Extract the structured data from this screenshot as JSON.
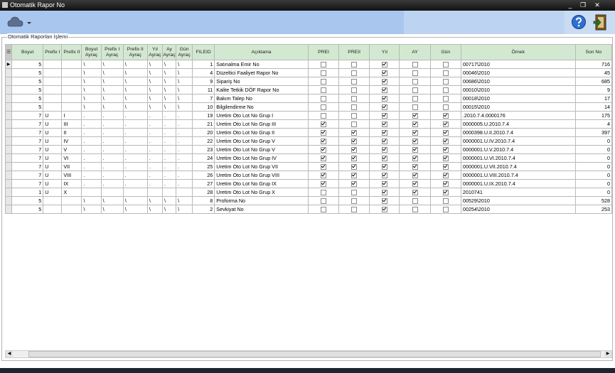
{
  "window": {
    "title": "Otomatik Rapor No"
  },
  "icons": {
    "app": "app-icon",
    "minimize": "minimize-icon",
    "restore": "restore-icon",
    "close": "close-icon",
    "toolbar_menu": "cloud-menu-icon",
    "help": "help-icon",
    "exit": "exit-door-icon",
    "scroll_left": "arrow-left-icon",
    "scroll_right": "arrow-right-icon"
  },
  "window_buttons": {
    "minimize": "_",
    "restore": "❐",
    "close": "✕"
  },
  "colors": {
    "toolbar": "#a9c6ee",
    "header": "#d3e8d0",
    "title_bar": "#1f1f1f"
  },
  "group": {
    "label": "Otomatik Raporlan İşlemi"
  },
  "grid": {
    "columns": [
      "Boyut",
      "Prefix I",
      "Prefix II",
      "Boyut Ayraç",
      "Prefix I Ayraç",
      "Prefix II Ayraç",
      "Yıl Ayraç",
      "Ay Ayraç",
      "Gün Ayraç",
      "FILEID",
      "Açıklama",
      "PREI",
      "PREII",
      "Yıl",
      "AY",
      "Gün",
      "Örnek",
      "Son No"
    ],
    "rows": [
      {
        "boyut": "5",
        "p1": "",
        "p2": "",
        "ba": "\\",
        "p1a": "\\",
        "p2a": "\\",
        "ya": "\\",
        "aa": "\\",
        "ga": "\\",
        "fileid": "1",
        "aciklama": "Satınalma Emir No",
        "prei": false,
        "preii": false,
        "yil": true,
        "ay": false,
        "gun": false,
        "ornek": "00717\\2010",
        "sonno": "716"
      },
      {
        "boyut": "5",
        "p1": "",
        "p2": "",
        "ba": "\\",
        "p1a": "\\",
        "p2a": "\\",
        "ya": "\\",
        "aa": "\\",
        "ga": "\\",
        "fileid": "4",
        "aciklama": "Düzeltici Faaliyet Rapor No",
        "prei": false,
        "preii": false,
        "yil": true,
        "ay": false,
        "gun": false,
        "ornek": "00046\\2010",
        "sonno": "45"
      },
      {
        "boyut": "5",
        "p1": "",
        "p2": "",
        "ba": "\\",
        "p1a": "\\",
        "p2a": "\\",
        "ya": "\\",
        "aa": "\\",
        "ga": "\\",
        "fileid": "9",
        "aciklama": "Sipariş No",
        "prei": false,
        "preii": false,
        "yil": true,
        "ay": false,
        "gun": false,
        "ornek": "00686\\2010",
        "sonno": "685"
      },
      {
        "boyut": "5",
        "p1": "",
        "p2": "",
        "ba": "\\",
        "p1a": "\\",
        "p2a": "\\",
        "ya": "\\",
        "aa": "\\",
        "ga": "\\",
        "fileid": "11",
        "aciklama": "Kalite Tetkik DÖF Rapor No",
        "prei": false,
        "preii": false,
        "yil": true,
        "ay": false,
        "gun": false,
        "ornek": "00010\\2010",
        "sonno": "9"
      },
      {
        "boyut": "5",
        "p1": "",
        "p2": "",
        "ba": "\\",
        "p1a": "\\",
        "p2a": "\\",
        "ya": "\\",
        "aa": "\\",
        "ga": "\\",
        "fileid": "7",
        "aciklama": "Bakım Talep No",
        "prei": false,
        "preii": false,
        "yil": true,
        "ay": false,
        "gun": false,
        "ornek": "00018\\2010",
        "sonno": "17"
      },
      {
        "boyut": "5",
        "p1": "",
        "p2": "",
        "ba": "\\",
        "p1a": "\\",
        "p2a": "\\",
        "ya": "\\",
        "aa": "\\",
        "ga": "\\",
        "fileid": "10",
        "aciklama": "Bilgilendirme No",
        "prei": false,
        "preii": false,
        "yil": true,
        "ay": false,
        "gun": false,
        "ornek": "00015\\2010",
        "sonno": "14"
      },
      {
        "boyut": "7",
        "p1": "U",
        "p2": "I",
        "ba": ".",
        "p1a": ".",
        "p2a": ".",
        "ya": ".",
        "aa": ".",
        "ga": ".",
        "fileid": "19",
        "aciklama": "Uretim Oto Lot No Grup I",
        "prei": false,
        "preii": false,
        "yil": true,
        "ay": true,
        "gun": true,
        "ornek": ".2010.7.4.0000176",
        "sonno": "175"
      },
      {
        "boyut": "7",
        "p1": "U",
        "p2": "III",
        "ba": ".",
        "p1a": ".",
        "p2a": ".",
        "ya": ".",
        "aa": ".",
        "ga": ".",
        "fileid": "21",
        "aciklama": "Uretim Oto Lot No Grup III",
        "prei": true,
        "preii": false,
        "yil": true,
        "ay": true,
        "gun": true,
        "ornek": "0000005.U.2010.7.4",
        "sonno": "4"
      },
      {
        "boyut": "7",
        "p1": "U",
        "p2": "II",
        "ba": ".",
        "p1a": ".",
        "p2a": ".",
        "ya": ".",
        "aa": ".",
        "ga": ".",
        "fileid": "20",
        "aciklama": "Uretim Oto Lot No Grup II",
        "prei": true,
        "preii": true,
        "yil": true,
        "ay": true,
        "gun": true,
        "ornek": "0000398.U.II.2010.7.4",
        "sonno": "397"
      },
      {
        "boyut": "7",
        "p1": "U",
        "p2": "IV",
        "ba": ".",
        "p1a": ".",
        "p2a": ".",
        "ya": ".",
        "aa": ".",
        "ga": ".",
        "fileid": "22",
        "aciklama": "Uretim Oto Lot No Grup V",
        "prei": true,
        "preii": true,
        "yil": true,
        "ay": true,
        "gun": true,
        "ornek": "0000001.U.IV.2010.7.4",
        "sonno": "0"
      },
      {
        "boyut": "7",
        "p1": "U",
        "p2": "V",
        "ba": ".",
        "p1a": ".",
        "p2a": ".",
        "ya": ".",
        "aa": ".",
        "ga": ".",
        "fileid": "23",
        "aciklama": "Uretim Oto Lot No Grup V",
        "prei": true,
        "preii": true,
        "yil": true,
        "ay": true,
        "gun": true,
        "ornek": "0000001.U.V.2010.7.4",
        "sonno": "0"
      },
      {
        "boyut": "7",
        "p1": "U",
        "p2": "VI",
        "ba": ".",
        "p1a": ".",
        "p2a": ".",
        "ya": ".",
        "aa": ".",
        "ga": ".",
        "fileid": "24",
        "aciklama": "Uretim Oto Lot No Grup IV",
        "prei": true,
        "preii": true,
        "yil": true,
        "ay": true,
        "gun": true,
        "ornek": "0000001.U.VI.2010.7.4",
        "sonno": "0"
      },
      {
        "boyut": "7",
        "p1": "U",
        "p2": "VII",
        "ba": ".",
        "p1a": ".",
        "p2a": ".",
        "ya": ".",
        "aa": ".",
        "ga": ".",
        "fileid": "25",
        "aciklama": "Uretim Oto Lot No Grup VII",
        "prei": true,
        "preii": true,
        "yil": true,
        "ay": true,
        "gun": true,
        "ornek": "0000001.U.VII.2010.7.4",
        "sonno": "0"
      },
      {
        "boyut": "7",
        "p1": "U",
        "p2": "VIII",
        "ba": ".",
        "p1a": ".",
        "p2a": ".",
        "ya": ".",
        "aa": ".",
        "ga": ".",
        "fileid": "26",
        "aciklama": "Uretim Oto Lot No Grup VIII",
        "prei": true,
        "preii": true,
        "yil": true,
        "ay": true,
        "gun": true,
        "ornek": "0000001.U.VIII.2010.7.4",
        "sonno": "0"
      },
      {
        "boyut": "7",
        "p1": "U",
        "p2": "IX",
        "ba": ".",
        "p1a": ".",
        "p2a": ".",
        "ya": ".",
        "aa": ".",
        "ga": ".",
        "fileid": "27",
        "aciklama": "Uretim Oto Lot No Grup IX",
        "prei": true,
        "preii": true,
        "yil": true,
        "ay": true,
        "gun": true,
        "ornek": "0000001.U.IX.2010.7.4",
        "sonno": "0"
      },
      {
        "boyut": "1",
        "p1": "U",
        "p2": "X",
        "ba": "",
        "p1a": "",
        "p2a": "",
        "ya": "",
        "aa": "",
        "ga": "",
        "fileid": "28",
        "aciklama": "Uretim Oto Lot No Grup X",
        "prei": false,
        "preii": false,
        "yil": true,
        "ay": true,
        "gun": true,
        "ornek": "2010741",
        "sonno": "0"
      },
      {
        "boyut": "5",
        "p1": "",
        "p2": "",
        "ba": "\\",
        "p1a": "\\",
        "p2a": "\\",
        "ya": "\\",
        "aa": "\\",
        "ga": "\\",
        "fileid": "8",
        "aciklama": "Proforma No",
        "prei": false,
        "preii": false,
        "yil": true,
        "ay": false,
        "gun": false,
        "ornek": "00529\\2010",
        "sonno": "528"
      },
      {
        "boyut": "5",
        "p1": "",
        "p2": "",
        "ba": "\\",
        "p1a": "\\",
        "p2a": "\\",
        "ya": "\\",
        "aa": "\\",
        "ga": "\\",
        "fileid": "2",
        "aciklama": "Sevkiyat No",
        "prei": false,
        "preii": false,
        "yil": true,
        "ay": false,
        "gun": false,
        "ornek": "00254\\2010",
        "sonno": "253"
      }
    ]
  }
}
